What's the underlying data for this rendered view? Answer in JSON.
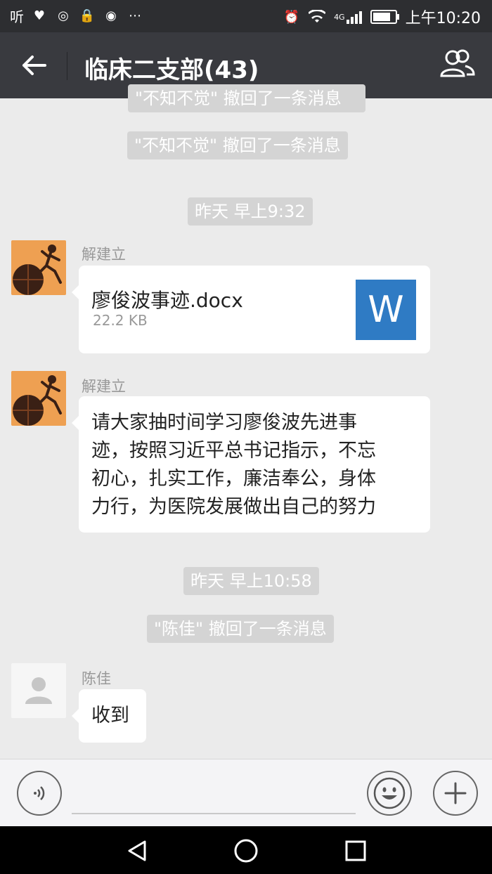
{
  "status_bar": {
    "left_label": "听",
    "time": "上午10:20",
    "network": "4G"
  },
  "header": {
    "title": "临床二支部(43)"
  },
  "messages": {
    "partial_system": "\"不知不觉\" 撤回了一条消息",
    "system_1": "\"不知不觉\" 撤回了一条消息",
    "time_1": "昨天 早上9:32",
    "sender_1": "解建立",
    "file_name": "廖俊波事迹.docx",
    "file_size": "22.2 KB",
    "file_icon_letter": "W",
    "sender_2": "解建立",
    "text_lines": [
      "请大家抽时间学习廖俊波先进事",
      "迹，按照习近平总书记指示，不忘",
      "初心，扎实工作，廉洁奉公，身体",
      "力行，为医院发展做出自己的努力"
    ],
    "time_2": "昨天 早上10:58",
    "system_2": "\"陈佳\" 撤回了一条消息",
    "sender_3": "陈佳",
    "reply": "收到"
  },
  "colors": {
    "status_bar_bg": "#2d2e31",
    "title_bar_bg": "#393a3f",
    "chat_bg": "#ebebeb",
    "word_blue": "#2f7bc4"
  },
  "icons": {
    "back": "arrow-left-icon",
    "contacts": "contacts-icon",
    "voice": "voice-icon",
    "emoji": "emoji-icon",
    "add": "plus-icon"
  }
}
